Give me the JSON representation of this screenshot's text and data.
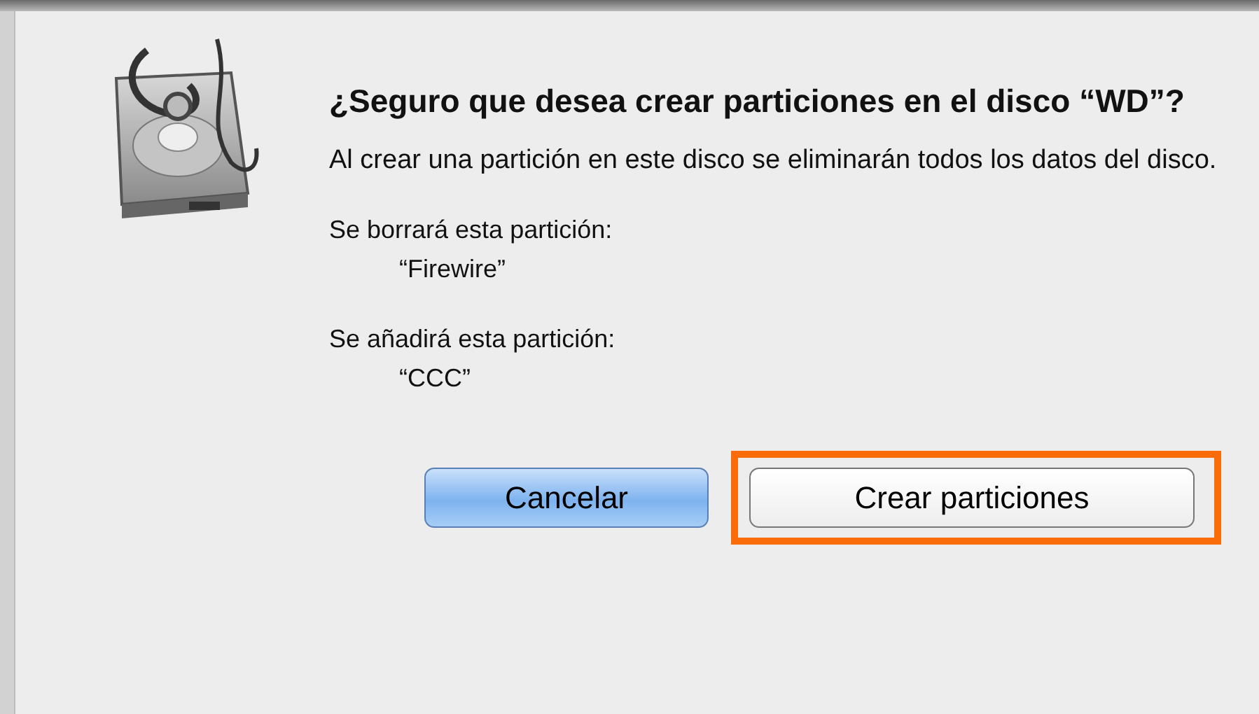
{
  "dialog": {
    "title": "¿Seguro que desea crear particiones en el disco “WD”?",
    "message": "Al crear una partición en este disco se eliminarán todos los datos del disco.",
    "changes": [
      {
        "label": "Se borrará esta partición:",
        "name": "“Firewire”"
      },
      {
        "label": "Se añadirá esta partición:",
        "name": "“CCC”"
      }
    ],
    "buttons": [
      {
        "label": "Cancelar",
        "kind": "default",
        "highlighted": false
      },
      {
        "label": "Crear particiones",
        "kind": "normal",
        "highlighted": true
      }
    ]
  }
}
